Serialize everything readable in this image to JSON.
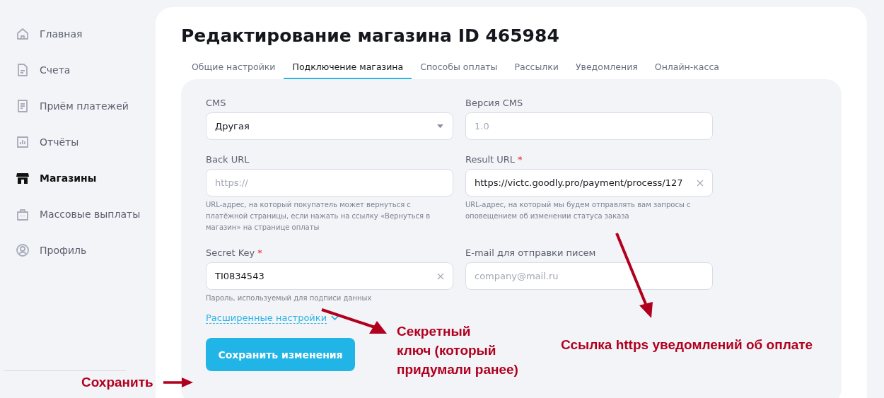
{
  "sidebar": {
    "items": [
      {
        "label": "Главная",
        "selected": false
      },
      {
        "label": "Счета",
        "selected": false
      },
      {
        "label": "Приём платежей",
        "selected": false
      },
      {
        "label": "Отчёты",
        "selected": false
      },
      {
        "label": "Магазины",
        "selected": true
      },
      {
        "label": "Массовые выплаты",
        "selected": false
      },
      {
        "label": "Профиль",
        "selected": false
      }
    ]
  },
  "page": {
    "title": "Редактирование магазина ID 465984"
  },
  "tabs": [
    {
      "label": "Общие настройки",
      "selected": false
    },
    {
      "label": "Подключение магазина",
      "selected": true
    },
    {
      "label": "Способы оплаты",
      "selected": false
    },
    {
      "label": "Рассылки",
      "selected": false
    },
    {
      "label": "Уведомления",
      "selected": false
    },
    {
      "label": "Онлайн-касса",
      "selected": false
    }
  ],
  "form": {
    "fields": [
      {
        "label": "CMS",
        "kind": "select",
        "value": "Другая"
      },
      {
        "label": "Версия CMS",
        "kind": "text",
        "placeholder": "1.0",
        "clearable": false
      },
      {
        "label": "Back URL",
        "kind": "text",
        "placeholder": "https://",
        "clearable": false,
        "hint": "URL-адрес, на который покупатель может вернуться с платёжной страницы, если нажать на ссылку «Вернуться в магазин» на странице оплаты"
      },
      {
        "label": "Result URL",
        "required_mark": "*",
        "kind": "text",
        "value": "https://victc.goodly.pro/payment/process/127",
        "clearable": true,
        "hint": "URL-адрес, на который мы будем отправлять вам запросы с оповещением об изменении статуса заказа"
      },
      {
        "label": "Secret Key",
        "required_mark": "*",
        "kind": "text",
        "value": "TI0834543",
        "clearable": true,
        "hint": "Пароль, используемый для подписи данных"
      },
      {
        "label": "E-mail для отправки писем",
        "kind": "text",
        "placeholder": "company@mail.ru",
        "clearable": false
      }
    ],
    "advanced_link": "Расширенные настройки",
    "save_button": "Сохранить изменения"
  },
  "annotations": [
    {
      "text": "Секретный\nключ (который\nпридумали ранее)",
      "kind": "secret"
    },
    {
      "text": "Ссылка https уведомлений об оплате",
      "kind": "result"
    },
    {
      "text": "Сохранить",
      "kind": "save"
    }
  ]
}
